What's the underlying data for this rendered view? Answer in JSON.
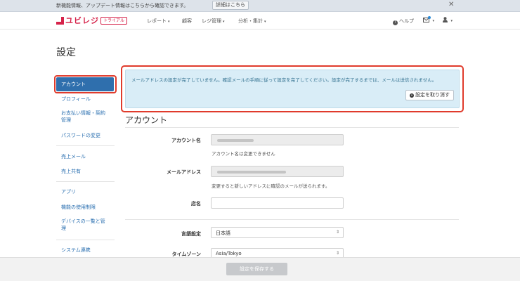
{
  "notice": {
    "text": "新機能情報、アップデート情報はこちらから確認できます。",
    "link": "詳細はこちら",
    "close": "✕"
  },
  "header": {
    "brand": "ユビレジ",
    "badge": "トライアル",
    "nav": [
      {
        "label": "レポート",
        "has_caret": true
      },
      {
        "label": "顧客",
        "has_caret": false
      },
      {
        "label": "レジ管理",
        "has_caret": true
      },
      {
        "label": "分析・集計",
        "has_caret": true
      }
    ],
    "help": "ヘルプ",
    "caret": "▾"
  },
  "page": {
    "title": "設定"
  },
  "sidebar": {
    "active": "アカウント",
    "items": [
      "プロフィール",
      "お支払い情報・契約管理",
      "パスワードの変更",
      "売上メール",
      "売上共有",
      "アプリ",
      "機能の使用制限",
      "デバイスの一覧と管理",
      "システム連携"
    ],
    "item3_line1": "お支払い情報・契約",
    "item3_line2": "管理",
    "item8_line1": "デバイスの一覧と管",
    "item8_line2": "理"
  },
  "alert": {
    "message": "メールアドレスの設定が完了していません。確認メールの手順に従って設定を完了してください。設定が完了するまでは、メールは送信されません。",
    "button": "設定を取り消す"
  },
  "account": {
    "section_title": "アカウント",
    "account_name_label": "アカウント名",
    "account_name_help": "アカウント名は変更できません",
    "email_label": "メールアドレス",
    "email_help": "変更すると新しいアドレスに確認のメールが送られます。",
    "store_label": "店名",
    "store_value": "",
    "language_label": "言語設定",
    "language_value": "日本語",
    "timezone_label": "タイムゾーン",
    "timezone_value": "Asia/Tokyo"
  },
  "footer": {
    "save": "設定を保存する"
  },
  "colors": {
    "accent": "#d6234a",
    "active": "#2f6fad",
    "highlight": "#e03b2c",
    "alert_bg": "#d9edf7"
  }
}
